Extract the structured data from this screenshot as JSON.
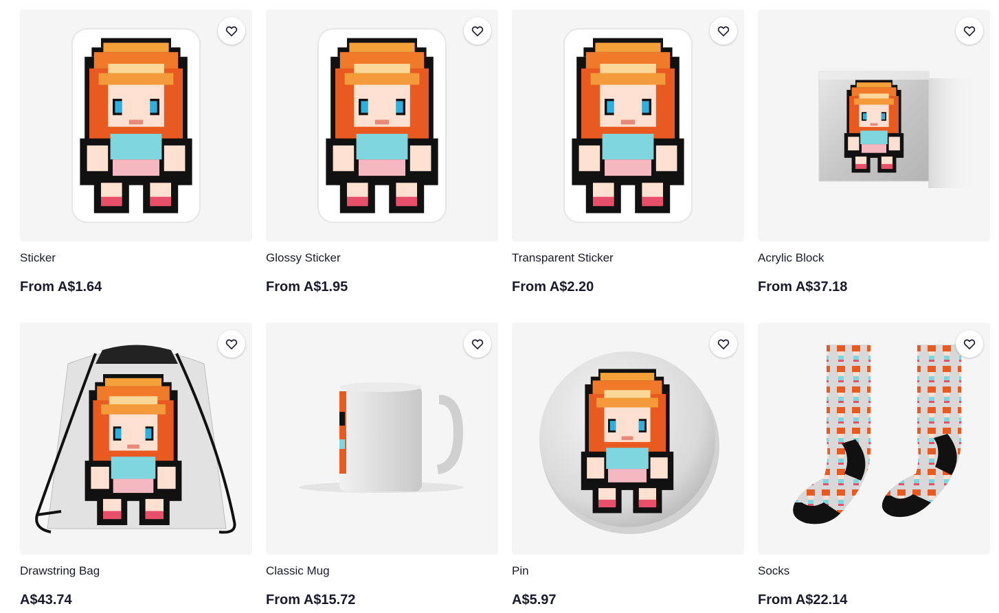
{
  "accent_color": "#1a1a2e",
  "card_background": "#f5f5f5",
  "favorite_icon": "heart-outline-icon",
  "products": [
    {
      "title": "Sticker",
      "price": "From A$1.64",
      "image": "pixel-girl-sticker"
    },
    {
      "title": "Glossy Sticker",
      "price": "From A$1.95",
      "image": "pixel-girl-glossy-sticker"
    },
    {
      "title": "Transparent Sticker",
      "price": "From A$2.20",
      "image": "pixel-girl-transparent-sticker"
    },
    {
      "title": "Acrylic Block",
      "price": "From A$37.18",
      "image": "pixel-girl-acrylic-block"
    },
    {
      "title": "Drawstring Bag",
      "price": "A$43.74",
      "image": "pixel-girl-drawstring-bag"
    },
    {
      "title": "Classic Mug",
      "price": "From A$15.72",
      "image": "pixel-girl-classic-mug"
    },
    {
      "title": "Pin",
      "price": "A$5.97",
      "image": "pixel-girl-pin"
    },
    {
      "title": "Socks",
      "price": "From A$22.14",
      "image": "pixel-girl-socks"
    }
  ]
}
